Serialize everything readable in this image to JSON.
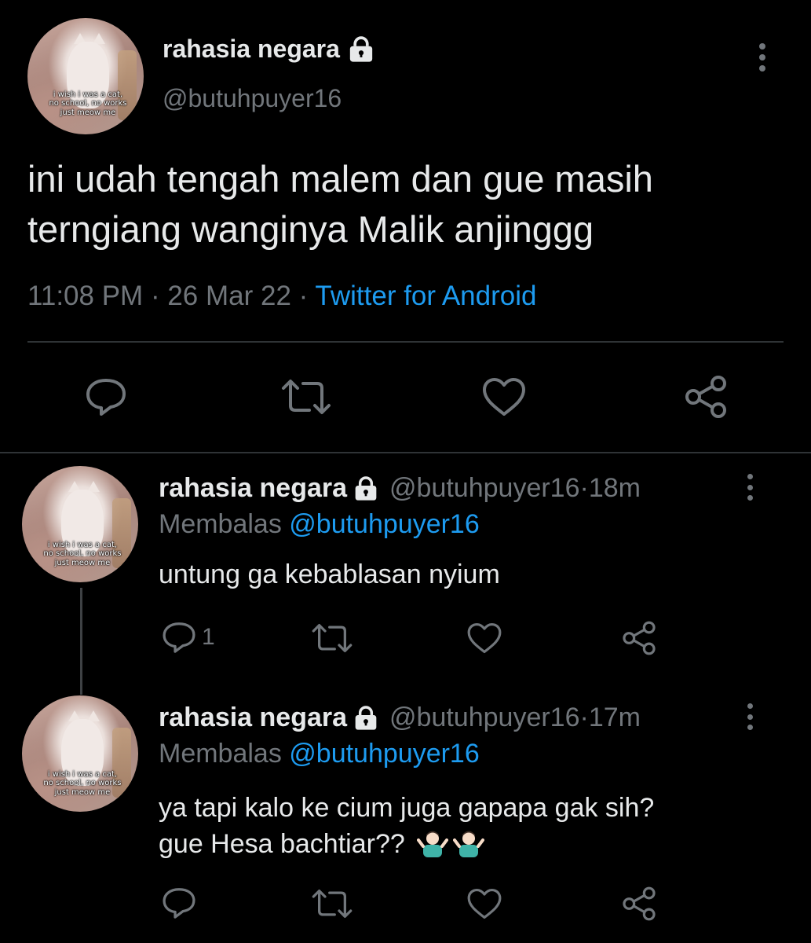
{
  "main_tweet": {
    "display_name": "rahasia negara",
    "handle": "@butuhpuyer16",
    "avatar_caption": [
      "i wish i was a cat,",
      "no school, no works",
      "just meow me"
    ],
    "text_line1": "ini udah tengah malem dan gue masih",
    "text_line2": "terngiang wanginya Malik anjinggg",
    "time": "11:08 PM",
    "date": "26 Mar 22",
    "source": "Twitter for Android",
    "separator": " · "
  },
  "replies": [
    {
      "display_name": "rahasia negara",
      "handle": "@butuhpuyer16",
      "time": "18m",
      "replying_prefix": "Membalas ",
      "replying_to": "@butuhpuyer16",
      "text_line1": "untung ga kebablasan nyium",
      "text_line2": "",
      "reply_count": "1"
    },
    {
      "display_name": "rahasia negara",
      "handle": "@butuhpuyer16",
      "time": "17m",
      "replying_prefix": "Membalas ",
      "replying_to": "@butuhpuyer16",
      "text_line1": "ya tapi kalo ke cium juga gapapa gak sih?",
      "text_line2": "gue Hesa bachtiar??",
      "reply_count": ""
    }
  ],
  "icons": {
    "lock": "lock-icon",
    "reply": "reply-icon",
    "retweet": "retweet-icon",
    "like": "like-icon",
    "share": "share-icon",
    "more": "more-icon",
    "shrug": "person-shrugging-emoji"
  },
  "colors": {
    "background": "#000000",
    "text": "#e7e9ea",
    "muted": "#71767b",
    "accent": "#1d9bf0",
    "divider": "#2f3336"
  }
}
